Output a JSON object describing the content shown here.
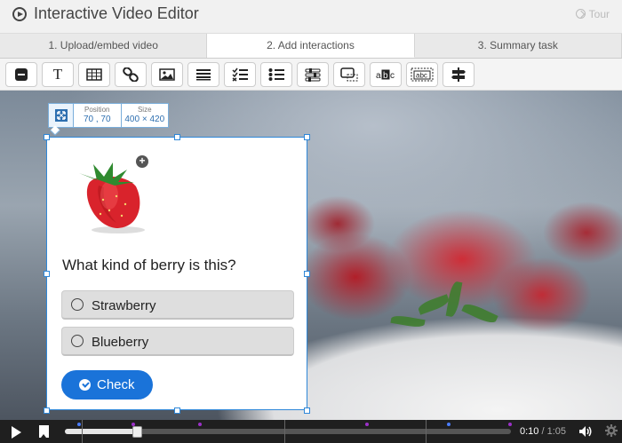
{
  "app": {
    "title": "Interactive Video Editor",
    "tour_label": "Tour"
  },
  "tabs": [
    {
      "label": "1. Upload/embed video",
      "active": false
    },
    {
      "label": "2. Add interactions",
      "active": true
    },
    {
      "label": "3. Summary task",
      "active": false
    }
  ],
  "toolbar": {
    "icons": [
      "label-icon",
      "text-icon",
      "table-icon",
      "link-icon",
      "image-icon",
      "statements-icon",
      "single-choice-set-icon",
      "multiple-choice-icon",
      "true-false-icon",
      "drag-and-drop-icon",
      "fill-in-blanks-icon",
      "drag-text-icon",
      "navigation-hotspot-icon"
    ],
    "text_tool_label": "T",
    "fill_blanks_label": "abc"
  },
  "position_box": {
    "position_label": "Position",
    "position_value": "70 , 70",
    "size_label": "Size",
    "size_value": "400 × 420"
  },
  "interaction": {
    "question": "What kind of berry is this?",
    "options": [
      "Strawberry",
      "Blueberry"
    ],
    "check_label": "Check",
    "add_image_icon": "+"
  },
  "player": {
    "current_time": "0:10",
    "separator": " / ",
    "duration": "1:05",
    "progress": 0.154,
    "colors": {
      "accent": "#1a73d9",
      "selection": "#2e87d8",
      "marker_blue": "#4a7dff",
      "marker_purple": "#9b30c8"
    }
  }
}
